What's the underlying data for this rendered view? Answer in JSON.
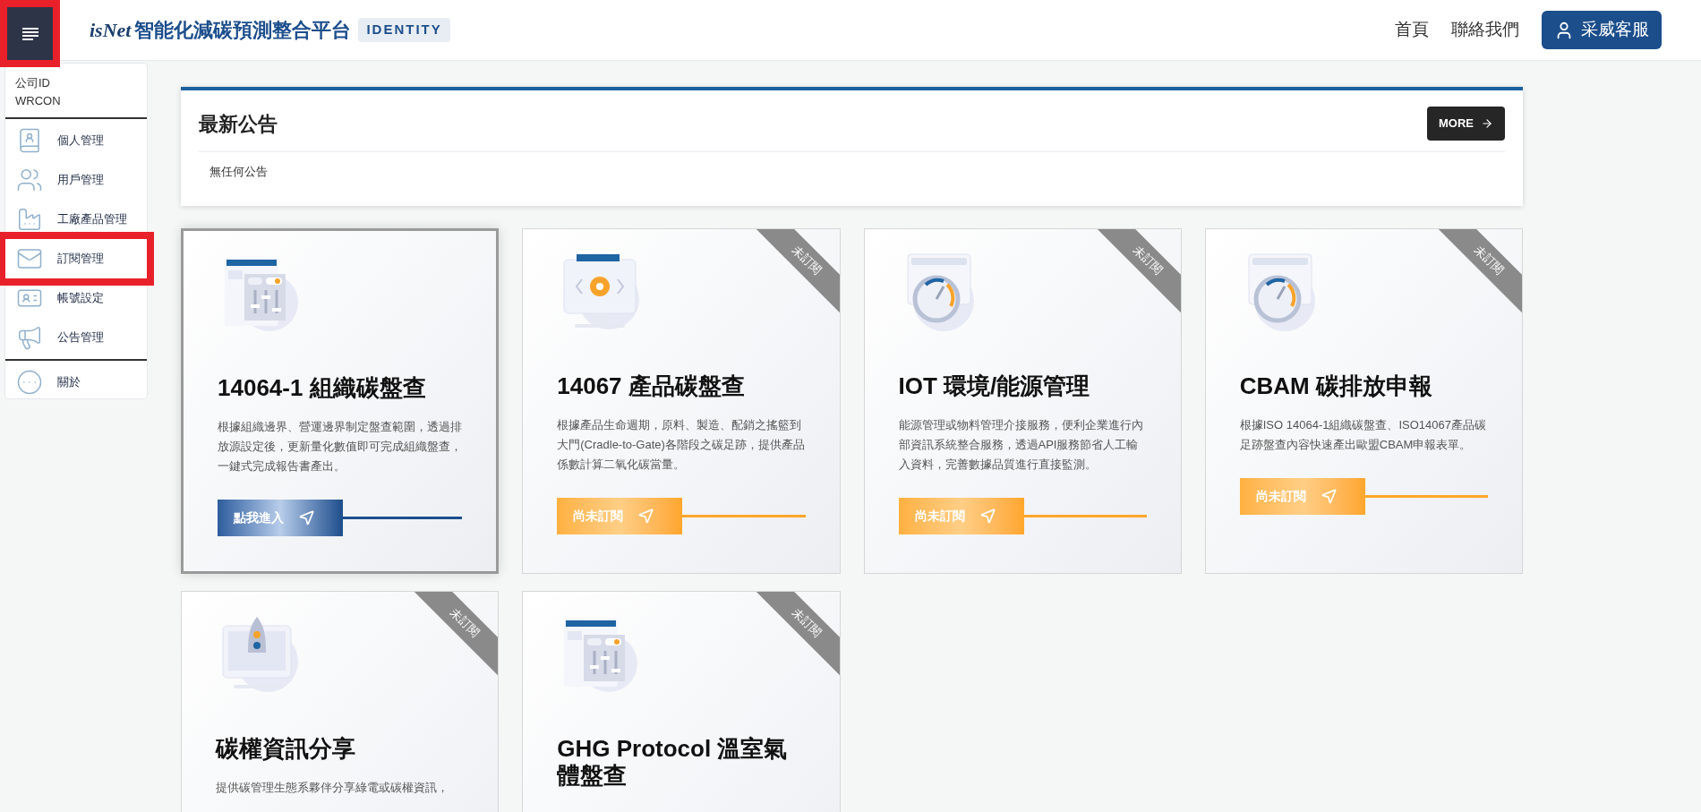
{
  "header": {
    "menu_button": {
      "highlighted": true
    },
    "logo": "isNet",
    "title": "智能化減碳預測整合平台",
    "badge": "IDENTITY",
    "nav": [
      "首頁",
      "聯絡我們"
    ],
    "service_button": "采威客服"
  },
  "sidebar": {
    "company_label": "公司ID",
    "company_id": "WRCON",
    "items": [
      {
        "label": "個人管理",
        "highlighted": false
      },
      {
        "label": "用戶管理",
        "highlighted": false
      },
      {
        "label": "工廠產品管理",
        "highlighted": false
      },
      {
        "label": "訂閱管理",
        "highlighted": true
      },
      {
        "label": "帳號設定",
        "highlighted": false
      },
      {
        "label": "公告管理",
        "highlighted": false
      }
    ],
    "footer_items": [
      {
        "label": "關於",
        "highlighted": false
      }
    ]
  },
  "announcements": {
    "title": "最新公告",
    "more_button": "MORE",
    "empty_text": "無任何公告"
  },
  "cards": [
    {
      "title": "14064-1 組織碳盤查",
      "description": "根據組織邊界、營運邊界制定盤查範圍，透過排放源設定後，更新量化數值即可完成組織盤查，一鍵式完成報告書產出。",
      "subscribed": true,
      "button": "點我進入"
    },
    {
      "title": "14067 產品碳盤查",
      "description": "根據產品生命週期，原料、製造、配銷之搖籃到大門(Cradle-to-Gate)各階段之碳足跡，提供產品係數計算二氧化碳當量。",
      "subscribed": false,
      "ribbon": "未訂閱",
      "button": "尚未訂閱"
    },
    {
      "title": "IOT 環境/能源管理",
      "description": "能源管理或物料管理介接服務，便利企業進行內部資訊系統整合服務，透過API服務節省人工輸入資料，完善數據品質進行直接監測。",
      "subscribed": false,
      "ribbon": "未訂閱",
      "button": "尚未訂閱"
    },
    {
      "title": "CBAM 碳排放申報",
      "description": "根據ISO 14064-1組織碳盤查、ISO14067產品碳足跡盤查內容快速產出歐盟CBAM申報表單。",
      "subscribed": false,
      "ribbon": "未訂閱",
      "button": "尚未訂閱"
    },
    {
      "title": "碳權資訊分享",
      "description": "提供碳管理生態系夥伴分享綠電或碳權資訊，",
      "subscribed": false,
      "ribbon": "未訂閱"
    },
    {
      "title": "GHG Protocol 溫室氣體盤查",
      "subscribed": false,
      "ribbon": "未訂閱"
    }
  ]
}
